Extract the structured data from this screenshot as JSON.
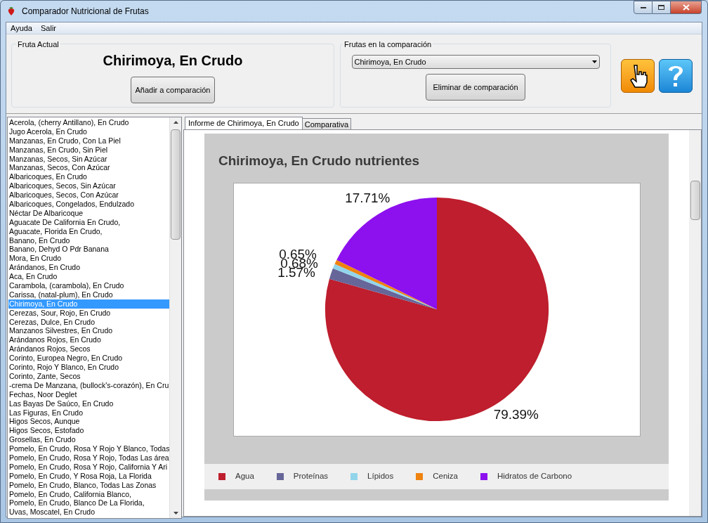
{
  "window": {
    "title": "Comparador Nutricional de Frutas"
  },
  "menu": [
    "Ayuda",
    "Salir"
  ],
  "current_fruit": {
    "group_label": "Fruta Actual",
    "name": "Chirimoya, En Crudo",
    "add_button": "Añadir a comparación"
  },
  "comparison": {
    "group_label": "Frutas en la comparación",
    "dropdown_value": "Chirimoya, En Crudo",
    "remove_button": "Eliminar de comparación"
  },
  "fruit_list": [
    {
      "label": "Acerola, (cherry Antillano), En Crudo",
      "selected": false
    },
    {
      "label": "Jugo Acerola, En Crudo",
      "selected": false
    },
    {
      "label": "Manzanas, En Crudo, Con La Piel",
      "selected": false
    },
    {
      "label": "Manzanas, En Crudo, Sin Piel",
      "selected": false
    },
    {
      "label": "Manzanas, Secos, Sin Azúcar",
      "selected": false
    },
    {
      "label": "Manzanas, Secos, Con Azúcar",
      "selected": false
    },
    {
      "label": "Albaricoques, En Crudo",
      "selected": false
    },
    {
      "label": "Albaricoques, Secos, Sin Azúcar",
      "selected": false
    },
    {
      "label": "Albaricoques, Secos, Con Azúcar",
      "selected": false
    },
    {
      "label": "Albaricoques, Congelados, Endulzado",
      "selected": false
    },
    {
      "label": "Néctar De Albaricoque",
      "selected": false
    },
    {
      "label": "Aguacate De California En Crudo,",
      "selected": false
    },
    {
      "label": "Aguacate, Florida En Crudo,",
      "selected": false
    },
    {
      "label": "Banano, En Crudo",
      "selected": false
    },
    {
      "label": "Banano, Dehyd O Pdr Banana",
      "selected": false
    },
    {
      "label": "Mora, En Crudo",
      "selected": false
    },
    {
      "label": "Arándanos, En Crudo",
      "selected": false
    },
    {
      "label": "Aca, En Crudo",
      "selected": false
    },
    {
      "label": "Carambola, (carambola), En Crudo",
      "selected": false
    },
    {
      "label": "Carissa, (natal-plum), En Crudo",
      "selected": false
    },
    {
      "label": "Chirimoya, En Crudo",
      "selected": true
    },
    {
      "label": "Cerezas, Sour, Rojo, En Crudo",
      "selected": false
    },
    {
      "label": "Cerezas, Dulce, En Crudo",
      "selected": false
    },
    {
      "label": "Manzanos Silvestres, En Crudo",
      "selected": false
    },
    {
      "label": "Arándanos Rojos, En Crudo",
      "selected": false
    },
    {
      "label": "Arándanos Rojos, Secos",
      "selected": false
    },
    {
      "label": "Corinto, Europea Negro, En Crudo",
      "selected": false
    },
    {
      "label": "Corinto, Rojo Y Blanco, En Crudo",
      "selected": false
    },
    {
      "label": "Corinto, Zante, Secos",
      "selected": false
    },
    {
      "label": "-crema De Manzana, (bullock's-corazón), En Cru",
      "selected": false
    },
    {
      "label": "Fechas, Noor Deglet",
      "selected": false
    },
    {
      "label": "Las Bayas De Saúco, En Crudo",
      "selected": false
    },
    {
      "label": "Las Figuras, En Crudo",
      "selected": false
    },
    {
      "label": "Higos Secos, Aunque",
      "selected": false
    },
    {
      "label": "Higos Secos, Estofado",
      "selected": false
    },
    {
      "label": "Grosellas, En Crudo",
      "selected": false
    },
    {
      "label": "Pomelo, En Crudo, Rosa Y Rojo Y Blanco, Todas",
      "selected": false
    },
    {
      "label": "Pomelo, En Crudo, Rosa Y Rojo, Todas Las área",
      "selected": false
    },
    {
      "label": "Pomelo, En Crudo, Rosa Y Rojo, California Y Ari",
      "selected": false
    },
    {
      "label": "Pomelo, En Crudo, Y Rosa Roja, La Florida",
      "selected": false
    },
    {
      "label": "Pomelo, En Crudo, Blanco, Todas Las Zonas",
      "selected": false
    },
    {
      "label": "Pomelo, En Crudo, California Blanco,",
      "selected": false
    },
    {
      "label": "Pomelo, En Crudo, Blanco De La Florida,",
      "selected": false
    },
    {
      "label": "Uvas, Moscatel, En Crudo",
      "selected": false
    }
  ],
  "tabs": [
    {
      "label": "Informe de Chirimoya, En Crudo",
      "selected": true
    },
    {
      "label": "Comparativa",
      "selected": false
    }
  ],
  "report": {
    "chart_data": {
      "type": "pie",
      "title": "Chirimoya, En Crudo nutrientes",
      "categories": [
        "Agua",
        "Proteínas",
        "Lípidos",
        "Ceniza",
        "Hidratos de Carbono"
      ],
      "values": [
        79.39,
        1.57,
        0.68,
        0.65,
        17.71
      ],
      "legend": true,
      "colors": [
        "#be1e2d",
        "#666699",
        "#92d5ea",
        "#ee8310",
        "#8d10ee"
      ],
      "value_labels": [
        "79.39%",
        "1.57%",
        "0.68%",
        "0.65%",
        "17.71%"
      ]
    }
  }
}
